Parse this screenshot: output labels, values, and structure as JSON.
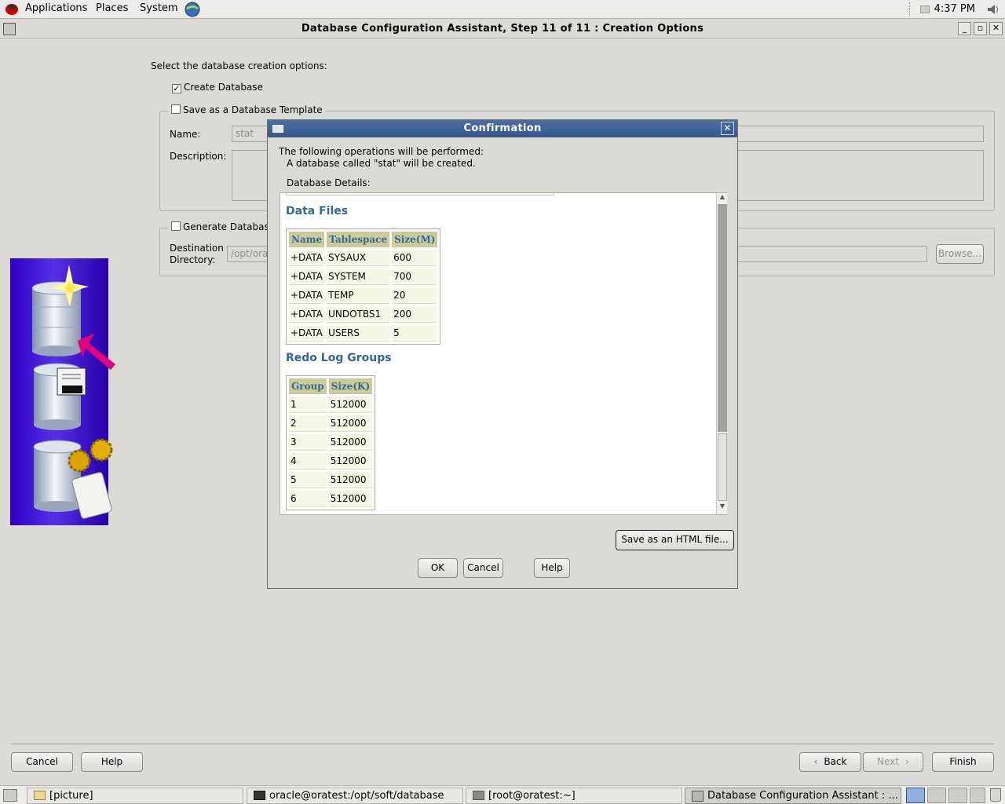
{
  "top_panel": {
    "menus": [
      "Applications",
      "Places",
      "System"
    ],
    "clock": "4:37 PM"
  },
  "window": {
    "title": "Database Configuration Assistant, Step 11 of 11 : Creation Options"
  },
  "options": {
    "prompt": "Select the database creation options:",
    "create_database_label": "Create Database",
    "create_database_checked": true,
    "save_template_label": "Save as a Database Template",
    "save_template_checked": false,
    "name_label": "Name:",
    "name_value": "stat",
    "description_label": "Description:",
    "generate_label": "Generate Database",
    "generate_checked": false,
    "destination_label_1": "Destination",
    "destination_label_2": "Directory:",
    "destination_value": "/opt/ora",
    "browse_label": "Browse..."
  },
  "footer": {
    "cancel": "Cancel",
    "help": "Help",
    "back": "Back",
    "next": "Next",
    "finish": "Finish"
  },
  "dialog": {
    "title": "Confirmation",
    "line1": "The following operations will be performed:",
    "line2": "A database called \"stat\" will be created.",
    "details_label": "Database Details:",
    "data_files": {
      "heading": "Data Files",
      "headers": [
        "Name",
        "Tablespace",
        "Size(M)"
      ],
      "rows": [
        [
          "+DATA",
          "SYSAUX",
          "600"
        ],
        [
          "+DATA",
          "SYSTEM",
          "700"
        ],
        [
          "+DATA",
          "TEMP",
          "20"
        ],
        [
          "+DATA",
          "UNDOTBS1",
          "200"
        ],
        [
          "+DATA",
          "USERS",
          "5"
        ]
      ]
    },
    "redo_logs": {
      "heading": "Redo Log Groups",
      "headers": [
        "Group",
        "Size(K)"
      ],
      "rows": [
        [
          "1",
          "512000"
        ],
        [
          "2",
          "512000"
        ],
        [
          "3",
          "512000"
        ],
        [
          "4",
          "512000"
        ],
        [
          "5",
          "512000"
        ],
        [
          "6",
          "512000"
        ]
      ]
    },
    "save_html": "Save as an HTML file...",
    "ok": "OK",
    "cancel": "Cancel",
    "help": "Help"
  },
  "taskbar": {
    "tasks": [
      "[picture]",
      "oracle@oratest:/opt/soft/database",
      "[root@oratest:~]",
      "Database Configuration Assistant : ..."
    ]
  }
}
